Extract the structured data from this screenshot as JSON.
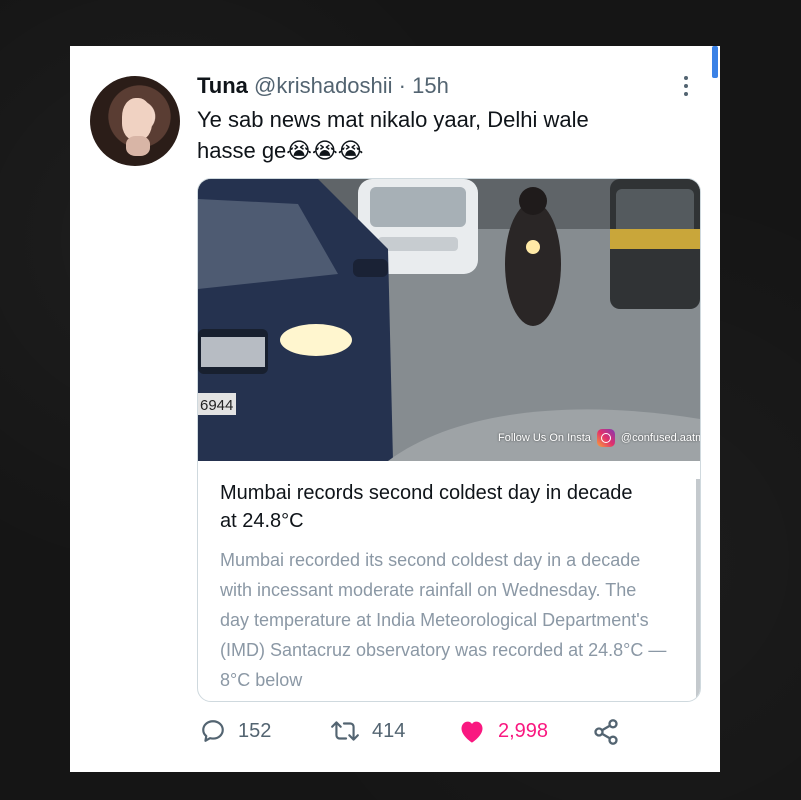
{
  "tweet": {
    "display_name": "Tuna",
    "handle": "@krishadoshii",
    "separator": "·",
    "time": "15h",
    "text_line1": "Ye sab news mat nikalo yaar, Delhi wale",
    "text_line2": "hasse ge😭😭😭"
  },
  "media": {
    "watermark_text": "Follow Us On Insta",
    "watermark_handle": "@confused.aatma",
    "plate_text": "6944",
    "news_title": "Mumbai records second coldest day in decade at 24.8°C",
    "news_body": "Mumbai recorded its second coldest day in a decade with incessant moderate rainfall on Wednesday. The day temperature at India Meteorological Department's (IMD) Santacruz observatory was recorded at 24.8°C — 8°C below"
  },
  "actions": {
    "replies": "152",
    "retweets": "414",
    "likes": "2,998"
  },
  "colors": {
    "like": "#f91880",
    "muted": "#536471",
    "accent": "#3b82e6"
  },
  "icons": [
    "more-icon",
    "reply-icon",
    "retweet-icon",
    "heart-icon",
    "share-icon",
    "instagram-icon"
  ]
}
